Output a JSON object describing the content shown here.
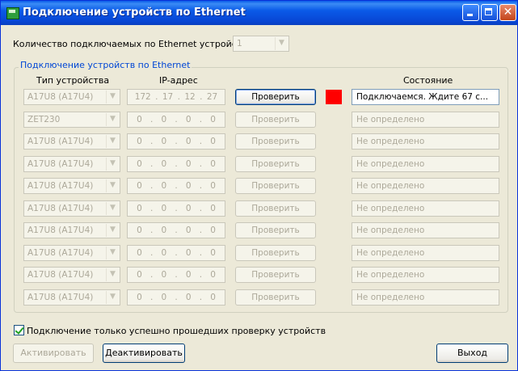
{
  "window": {
    "title": "Подключение устройств по Ethernet"
  },
  "count": {
    "label": "Количество подключаемых по Ethernet устройств:",
    "value": "1"
  },
  "group": {
    "title": "Подключение устройств по Ethernet",
    "col_type": "Тип устройства",
    "col_ip": "IP-адрес",
    "col_state": "Состояние"
  },
  "colors": {
    "indicator_red": "#ff0000"
  },
  "rows": [
    {
      "type": "A17U8 (A17U4)",
      "ip": [
        "172",
        "17",
        "12",
        "27"
      ],
      "button": "Проверить",
      "status": "Подключаемся. Ждите 67 с...",
      "enabled": true,
      "indicator": "red"
    },
    {
      "type": "ZET230",
      "ip": [
        "0",
        "0",
        "0",
        "0"
      ],
      "button": "Проверить",
      "status": "Не определено",
      "enabled": false
    },
    {
      "type": "A17U8 (A17U4)",
      "ip": [
        "0",
        "0",
        "0",
        "0"
      ],
      "button": "Проверить",
      "status": "Не определено",
      "enabled": false
    },
    {
      "type": "A17U8 (A17U4)",
      "ip": [
        "0",
        "0",
        "0",
        "0"
      ],
      "button": "Проверить",
      "status": "Не определено",
      "enabled": false
    },
    {
      "type": "A17U8 (A17U4)",
      "ip": [
        "0",
        "0",
        "0",
        "0"
      ],
      "button": "Проверить",
      "status": "Не определено",
      "enabled": false
    },
    {
      "type": "A17U8 (A17U4)",
      "ip": [
        "0",
        "0",
        "0",
        "0"
      ],
      "button": "Проверить",
      "status": "Не определено",
      "enabled": false
    },
    {
      "type": "A17U8 (A17U4)",
      "ip": [
        "0",
        "0",
        "0",
        "0"
      ],
      "button": "Проверить",
      "status": "Не определено",
      "enabled": false
    },
    {
      "type": "A17U8 (A17U4)",
      "ip": [
        "0",
        "0",
        "0",
        "0"
      ],
      "button": "Проверить",
      "status": "Не определено",
      "enabled": false
    },
    {
      "type": "A17U8 (A17U4)",
      "ip": [
        "0",
        "0",
        "0",
        "0"
      ],
      "button": "Проверить",
      "status": "Не определено",
      "enabled": false
    },
    {
      "type": "A17U8 (A17U4)",
      "ip": [
        "0",
        "0",
        "0",
        "0"
      ],
      "button": "Проверить",
      "status": "Не определено",
      "enabled": false
    }
  ],
  "checkbox": {
    "label": "Подключение только успешно прошедших проверку устройств",
    "checked": true
  },
  "buttons": {
    "activate": "Активировать",
    "deactivate": "Деактивировать",
    "exit": "Выход"
  }
}
